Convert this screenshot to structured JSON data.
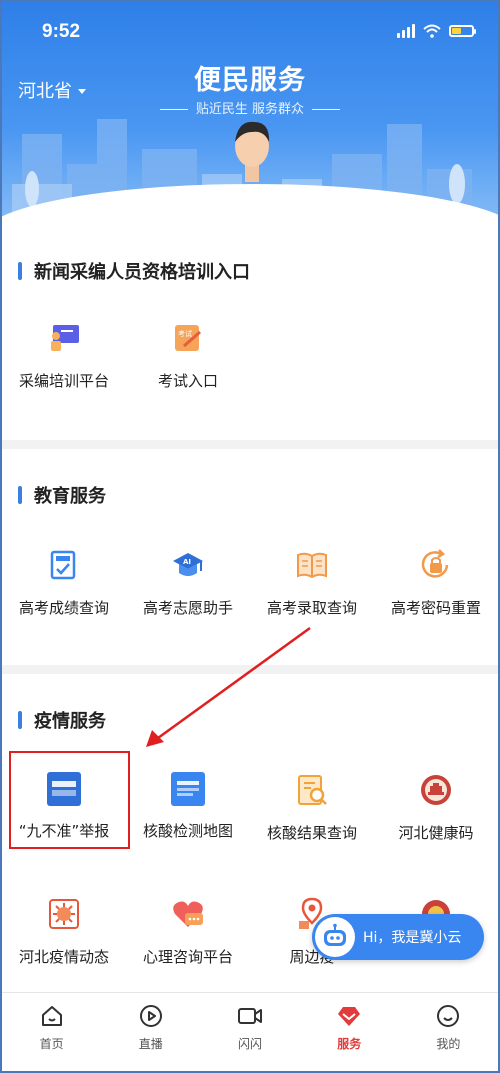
{
  "status_bar": {
    "time": "9:52"
  },
  "header": {
    "province": "河北省",
    "title": "便民服务",
    "subtitle": "贴近民生 服务群众"
  },
  "sections": [
    {
      "title": "新闻采编人员资格培训入口",
      "items": [
        {
          "label": "采编培训平台",
          "icon": "training-platform-icon"
        },
        {
          "label": "考试入口",
          "icon": "exam-icon"
        }
      ]
    },
    {
      "title": "教育服务",
      "items": [
        {
          "label": "高考成绩查询",
          "icon": "score-query-icon"
        },
        {
          "label": "高考志愿助手",
          "icon": "ai-graduation-icon"
        },
        {
          "label": "高考录取查询",
          "icon": "book-icon"
        },
        {
          "label": "高考密码重置",
          "icon": "lock-reset-icon"
        }
      ]
    },
    {
      "title": "疫情服务",
      "items": [
        {
          "label": "“九不准”举报",
          "icon": "report-icon",
          "badge": "\"九不准\""
        },
        {
          "label": "核酸检测地图",
          "icon": "test-map-icon"
        },
        {
          "label": "核酸结果查询",
          "icon": "result-search-icon"
        },
        {
          "label": "河北健康码",
          "icon": "health-code-icon"
        },
        {
          "label": "河北疫情动态",
          "icon": "virus-icon"
        },
        {
          "label": "心理咨询平台",
          "icon": "heart-chat-icon"
        },
        {
          "label": "周边疫",
          "icon": "location-icon"
        },
        {
          "label": "",
          "icon": "emblem-icon"
        }
      ]
    }
  ],
  "assistant": {
    "text": "Hi，我是冀小云"
  },
  "tabs": [
    {
      "label": "首页",
      "icon": "home-icon"
    },
    {
      "label": "直播",
      "icon": "play-icon"
    },
    {
      "label": "闪闪",
      "icon": "video-icon"
    },
    {
      "label": "服务",
      "icon": "service-icon",
      "active": true
    },
    {
      "label": "我的",
      "icon": "profile-icon"
    }
  ],
  "colors": {
    "primary": "#3a86f0",
    "active_tab": "#e23b3b",
    "highlight": "#e02020",
    "section_bar": "#3b7fe0"
  }
}
